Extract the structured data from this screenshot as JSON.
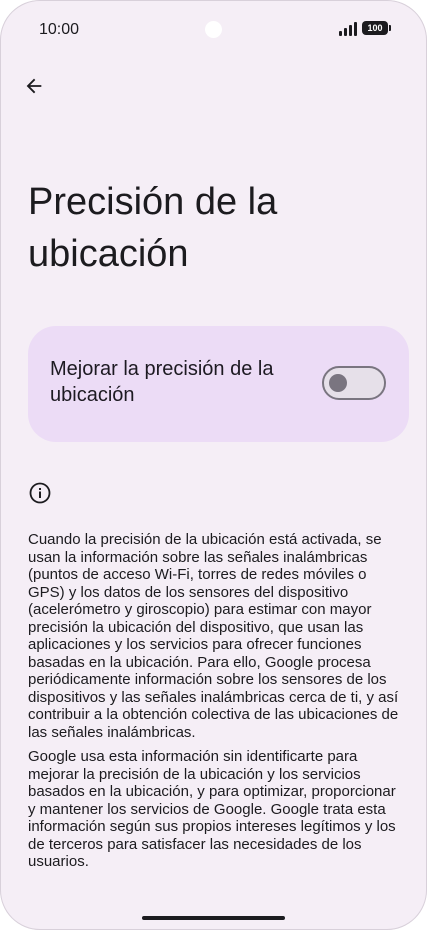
{
  "status_bar": {
    "time": "10:00",
    "battery_level": "100"
  },
  "icons": {
    "back": "arrow-back-icon",
    "info": "info-icon",
    "signal": "signal-icon",
    "battery": "battery-icon"
  },
  "colors": {
    "background": "#f5eef6",
    "card": "#ecdcf6",
    "switch_off": "#7a7580",
    "text": "#1c1b1f"
  },
  "page": {
    "title": "Precisión de la ubicación"
  },
  "setting": {
    "label": "Mejorar la precisión de la ubicación",
    "enabled": false
  },
  "info": {
    "paragraph1": "Cuando la precisión de la ubicación está activada, se usan la información sobre las señales inalámbricas (puntos de acceso Wi-Fi, torres de redes móviles o GPS) y los datos de los sensores del dispositivo (acelerómetro y giroscopio) para estimar con mayor precisión la ubicación del dispositivo, que usan las aplicaciones y los servicios para ofrecer funciones basadas en la ubicación. Para ello, Google procesa periódicamente información sobre los sensores de los dispositivos y las señales inalámbricas cerca de ti, y así contribuir a la obtención colectiva de las ubicaciones de las señales inalámbricas.",
    "paragraph2": "Google usa esta información sin identificarte para mejorar la precisión de la ubicación y los servicios basados en la ubicación, y para optimizar, proporcionar y mantener los servicios de Google. Google trata esta información según sus propios intereses legítimos y los de terceros para satisfacer las necesidades de los usuarios."
  }
}
